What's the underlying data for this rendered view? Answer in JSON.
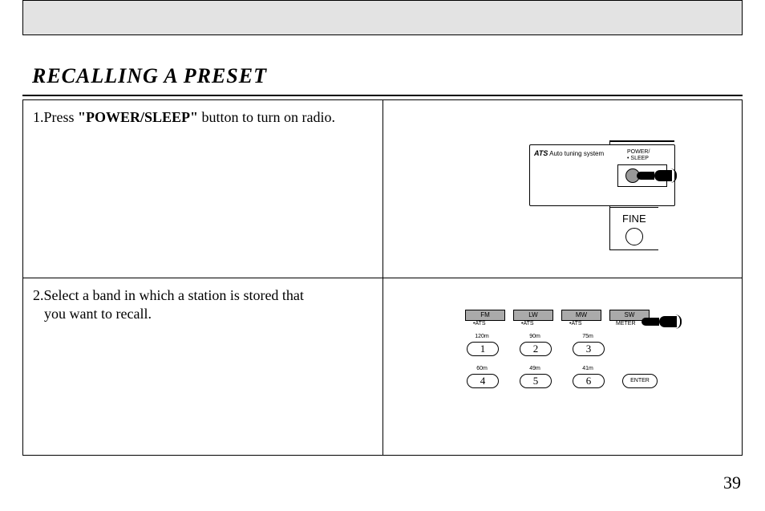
{
  "header_band": "",
  "title": "RECALLING A PRESET",
  "steps": {
    "s1_prefix": "1.Press ",
    "s1_bold": "\"POWER/SLEEP\"",
    "s1_suffix": " button to turn on radio.",
    "s2_line1": "2.Select a band in which a station is stored that",
    "s2_line2": "you want to recall."
  },
  "illus1": {
    "ats_bold": "ATS",
    "ats_text": " Auto tuning system",
    "power_label_1": "POWER/",
    "power_label_2": "• SLEEP",
    "fine_label": "FINE"
  },
  "illus2": {
    "bands": {
      "fm": {
        "label": "FM",
        "sub": "•ATS"
      },
      "lw": {
        "label": "LW",
        "sub": "•ATS"
      },
      "mw": {
        "label": "MW",
        "sub": "•ATS"
      },
      "sw": {
        "label": "SW",
        "sub": "METER"
      }
    },
    "row1": {
      "b1": {
        "top": "120m",
        "num": "1"
      },
      "b2": {
        "top": "90m",
        "num": "2"
      },
      "b3": {
        "top": "75m",
        "num": "3"
      }
    },
    "row2": {
      "b4": {
        "top": "60m",
        "num": "4"
      },
      "b5": {
        "top": "49m",
        "num": "5"
      },
      "b6": {
        "top": "41m",
        "num": "6"
      }
    },
    "enter": "ENTER"
  },
  "page_number": "39"
}
